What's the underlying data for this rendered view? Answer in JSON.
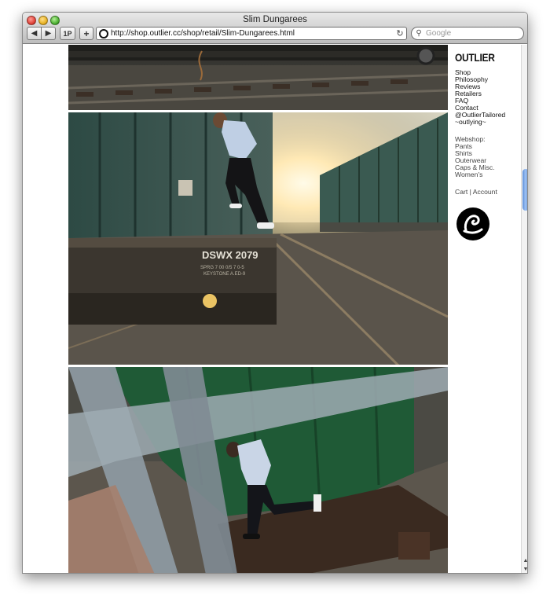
{
  "window": {
    "title": "Slim Dungarees"
  },
  "toolbar": {
    "back_label": "◀",
    "forward_label": "▶",
    "bookmarks_label": "1P",
    "add_label": "+",
    "url": "http://shop.outlier.cc/shop/retail/Slim-Dungarees.html",
    "reload_label": "↻",
    "search_placeholder": "Google"
  },
  "sidebar": {
    "brand": "OUTLIER",
    "nav": [
      {
        "label": "Shop"
      },
      {
        "label": "Philosophy"
      },
      {
        "label": "Reviews"
      },
      {
        "label": "Retailers"
      },
      {
        "label": "FAQ"
      },
      {
        "label": "Contact"
      },
      {
        "label": "@OutlierTailored"
      },
      {
        "label": "~outlying~"
      }
    ],
    "webshop_heading": "Webshop:",
    "webshop": [
      {
        "label": "Pants"
      },
      {
        "label": "Shirts"
      },
      {
        "label": "Outerwear"
      },
      {
        "label": "Caps & Misc."
      },
      {
        "label": "Women's"
      }
    ],
    "cart": "Cart",
    "separator": "|",
    "account": "Account"
  },
  "photos": {
    "railcar_text_1": "DSWX 2079",
    "railcar_text_2": "SPRG 7 00 0/5 7 0-5",
    "railcar_text_3": "KEYSTONE A.ED-9"
  },
  "colors": {
    "window_chrome": "#bdbdbd",
    "scroll_thumb": "#7ea8e6",
    "sidebar_text": "#111111"
  }
}
